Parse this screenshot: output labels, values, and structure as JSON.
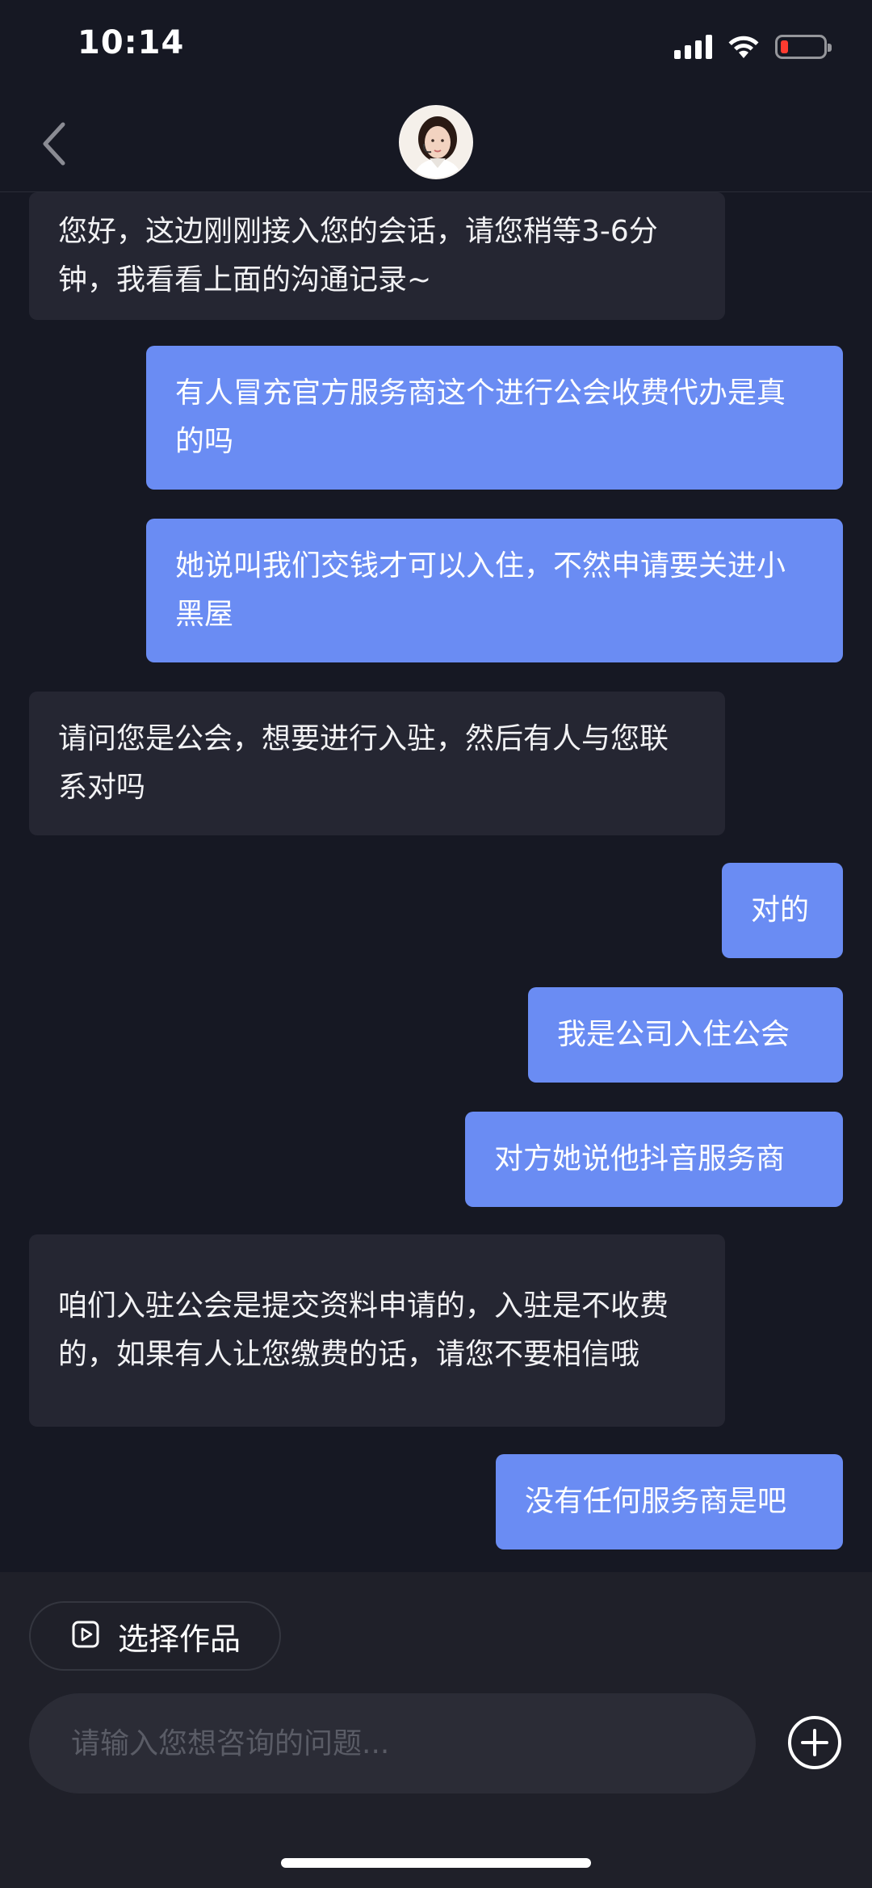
{
  "status_bar": {
    "time": "10:14",
    "battery_color": "#ff3b30"
  },
  "header": {
    "back_icon": "chevron-left-icon",
    "avatar": "customer-service-agent-avatar"
  },
  "messages": [
    {
      "side": "incoming",
      "text": "您好，这边刚刚接入您的会话，请您稍等3-6分钟，我看看上面的沟通记录~"
    },
    {
      "side": "outgoing",
      "text": "有人冒充官方服务商这个进行公会收费代办是真的吗"
    },
    {
      "side": "outgoing",
      "text": "她说叫我们交钱才可以入住，不然申请要关进小黑屋"
    },
    {
      "side": "incoming",
      "text": "请问您是公会，想要进行入驻，然后有人与您联系对吗"
    },
    {
      "side": "outgoing",
      "text": "对的"
    },
    {
      "side": "outgoing",
      "text": "我是公司入住公会"
    },
    {
      "side": "outgoing",
      "text": "对方她说他抖音服务商"
    },
    {
      "side": "incoming",
      "text": "咱们入驻公会是提交资料申请的，入驻是不收费的，如果有人让您缴费的话，请您不要相信哦"
    },
    {
      "side": "outgoing",
      "text": "没有任何服务商是吧"
    }
  ],
  "composer": {
    "select_work_label": "选择作品",
    "select_work_icon": "video-play-icon",
    "input_placeholder": "请输入您想咨询的问题...",
    "plus_icon": "plus-circle-icon"
  },
  "colors": {
    "background": "#161823",
    "incoming_bubble": "#252632",
    "outgoing_bubble": "#6a8cf3",
    "composer_background": "#1f2029"
  }
}
